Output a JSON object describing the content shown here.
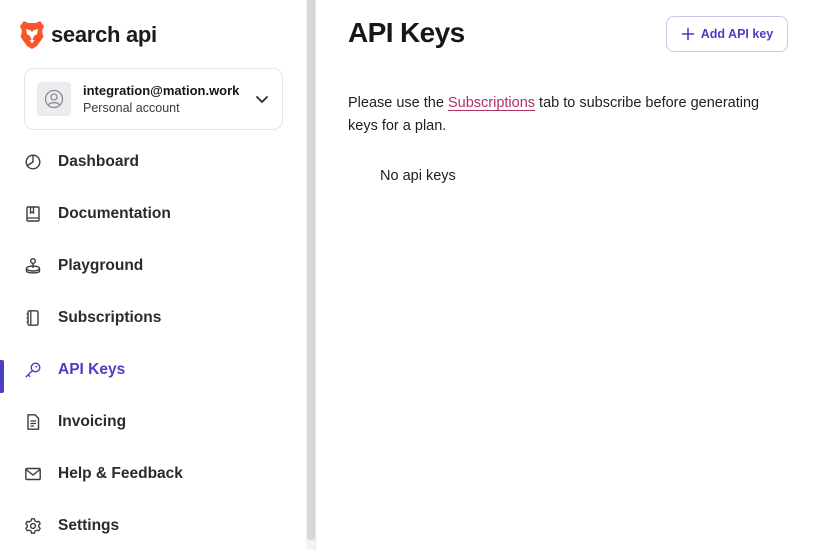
{
  "brand": {
    "name": "search api",
    "logo_icon": "brave-lion-icon",
    "accent": "#fb542b"
  },
  "account": {
    "email": "integration@mation.work",
    "type": "Personal account"
  },
  "nav": {
    "items": [
      {
        "label": "Dashboard",
        "icon": "dashboard-icon"
      },
      {
        "label": "Documentation",
        "icon": "book-icon"
      },
      {
        "label": "Playground",
        "icon": "joystick-icon"
      },
      {
        "label": "Subscriptions",
        "icon": "subscriptions-icon"
      },
      {
        "label": "API Keys",
        "icon": "key-icon",
        "active": true
      },
      {
        "label": "Invoicing",
        "icon": "invoice-icon"
      },
      {
        "label": "Help & Feedback",
        "icon": "mail-icon"
      },
      {
        "label": "Settings",
        "icon": "gear-icon"
      }
    ]
  },
  "main": {
    "title": "API Keys",
    "add_button_label": "Add API key",
    "notice_prefix": "Please use the ",
    "notice_link": "Subscriptions",
    "notice_suffix": " tab to subscribe before generating keys for a plan.",
    "empty_text": "No api keys"
  },
  "colors": {
    "accent": "#4a3fc4",
    "link": "#b0306a"
  }
}
